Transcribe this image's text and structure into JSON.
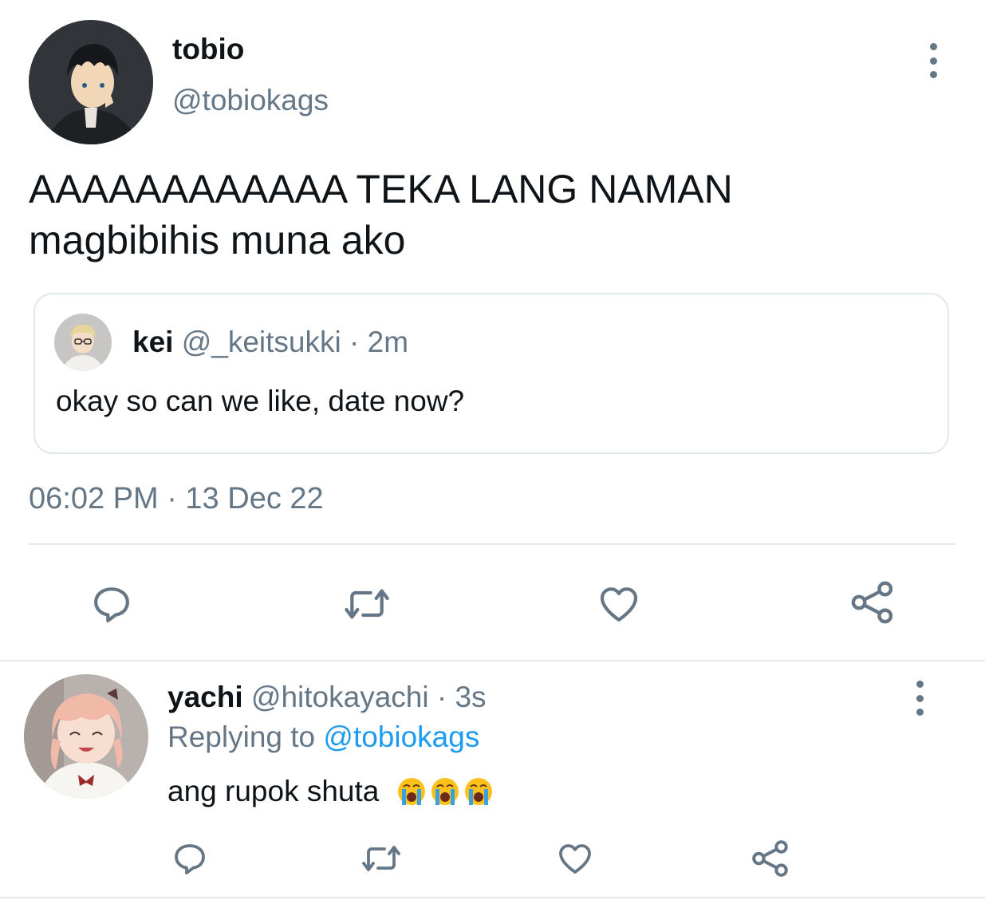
{
  "main_tweet": {
    "display_name": "tobio",
    "handle": "@tobiokags",
    "text_line1": "AAAAAAAAAAAA TEKA LANG NAMAN",
    "text_line2": "magbibihis muna ako",
    "timestamp": "06:02 PM · 13 Dec 22",
    "avatar_icon": "anime-boy-avatar",
    "quoted": {
      "display_name": "kei",
      "handle": "@_keitsukki",
      "time": "· 2m",
      "text": "okay so can we like, date now?",
      "avatar_icon": "anime-glasses-boy-avatar"
    },
    "actions": [
      "reply-icon",
      "retweet-icon",
      "like-icon",
      "share-icon"
    ]
  },
  "reply": {
    "display_name": "yachi",
    "handle": "@hitokayachi",
    "time": "· 3s",
    "replying_prefix": "Replying to",
    "replying_handle": "@tobiokags",
    "text": "ang rupok shuta",
    "emojis": [
      "crying-face",
      "crying-face",
      "crying-face"
    ],
    "avatar_icon": "anime-girl-avatar",
    "actions": [
      "reply-icon",
      "retweet-icon",
      "like-icon",
      "share-icon"
    ]
  },
  "colors": {
    "text": "#0f1419",
    "muted": "#657786",
    "link": "#1d9bf0",
    "divider": "#e1e8ed",
    "icon": "#657786"
  }
}
